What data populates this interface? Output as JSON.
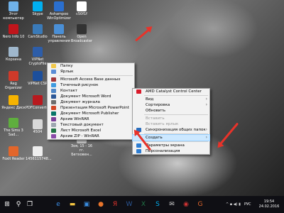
{
  "desktop_icons": [
    {
      "label": "Этот компьютер",
      "icon": "computer-icon",
      "color": "#6fb1e8"
    },
    {
      "label": "Skype",
      "icon": "skype-icon",
      "color": "#00aff0"
    },
    {
      "label": "Ashampoo WinOptimizer",
      "icon": "ashampoo-icon",
      "color": "#2a6fcf"
    },
    {
      "label": "c50f1f",
      "icon": "image-file-icon",
      "color": "#ffffff"
    },
    {
      "label": "Nero Info 10",
      "icon": "nero-icon",
      "color": "#c0151b"
    },
    {
      "label": "CamStudio",
      "icon": "camstudio-icon",
      "color": "#3a7ab8"
    },
    {
      "label": "Панель управления",
      "icon": "control-panel-icon",
      "color": "#4a8fd6"
    },
    {
      "label": "Open Broadcaster",
      "icon": "obs-icon",
      "color": "#333333"
    },
    {
      "label": "Корзина",
      "icon": "recycle-bin-icon",
      "color": "#9fb7cc"
    },
    {
      "label": "VIPNet CryptoFile",
      "icon": "vipnet-icon",
      "color": "#2d5da8"
    },
    {
      "label": "Reg Organizer",
      "icon": "reg-organizer-icon",
      "color": "#d03a2a"
    },
    {
      "label": "ViPNet CSP",
      "icon": "vipnet-csp-icon",
      "color": "#1c4f9c"
    },
    {
      "label": "Яндекс Диск",
      "icon": "yandex-disk-icon",
      "color": "#f6b300"
    },
    {
      "label": "PDFConverter",
      "icon": "pdf-icon",
      "color": "#b8191e"
    },
    {
      "label": "The Sims 3 Sad...",
      "icon": "sims-icon",
      "color": "#5fae3e"
    },
    {
      "label": "4504",
      "icon": "image-file-icon",
      "color": "#d8d8d8"
    },
    {
      "label": "Зоя, 15 - 16 гг. Бетховен...",
      "icon": "image-file-icon",
      "color": "#c8c8c8"
    },
    {
      "label": "Foxit Reader",
      "icon": "foxit-icon",
      "color": "#e2662b"
    },
    {
      "label": "1456115748...",
      "icon": "image-file-icon",
      "color": "#eeeeee"
    }
  ],
  "new_submenu": {
    "items": [
      {
        "label": "Папку",
        "icon": "folder-icon",
        "color": "#f2c94c"
      },
      {
        "label": "Ярлык",
        "icon": "shortcut-icon",
        "color": "#5b8dd6"
      },
      {
        "separator": true
      },
      {
        "label": "Microsoft Access Base данных",
        "icon": "access-icon",
        "color": "#a4373a"
      },
      {
        "label": "Точечный рисунок",
        "icon": "bitmap-icon",
        "color": "#3f9be0"
      },
      {
        "label": "Контакт",
        "icon": "contact-icon",
        "color": "#4f86c6"
      },
      {
        "label": "Документ Microsoft Word",
        "icon": "word-icon",
        "color": "#2b5797"
      },
      {
        "label": "Документ журнала",
        "icon": "journal-icon",
        "color": "#6d6d6d"
      },
      {
        "label": "Презентация Microsoft PowerPoint",
        "icon": "powerpoint-icon",
        "color": "#d24726"
      },
      {
        "label": "Документ Microsoft Publisher",
        "icon": "publisher-icon",
        "color": "#077568"
      },
      {
        "label": "Архив WinRAR",
        "icon": "winrar-icon",
        "color": "#7a3f99"
      },
      {
        "label": "Текстовый документ",
        "icon": "text-file-icon",
        "color": "#9ea7b1"
      },
      {
        "label": "Лист Microsoft Excel",
        "icon": "excel-icon",
        "color": "#217346"
      },
      {
        "label": "Архив ZIP - WinRAR",
        "icon": "zip-icon",
        "color": "#8a4aa8"
      }
    ]
  },
  "context_menu": {
    "items": [
      {
        "label": "AMD Catalyst Control Center",
        "icon": "amd-icon",
        "color": "#d91a2a"
      },
      {
        "separator": true
      },
      {
        "label": "Вид",
        "arrow": true
      },
      {
        "label": "Сортировка",
        "arrow": true
      },
      {
        "label": "Обновить"
      },
      {
        "separator": true
      },
      {
        "label": "Вставить",
        "disabled": true
      },
      {
        "label": "Вставить ярлык",
        "disabled": true
      },
      {
        "label": "Синхронизация общих папок",
        "icon": "sync-icon",
        "color": "#2a6ebd",
        "arrow": true
      },
      {
        "separator": true
      },
      {
        "label": "Создать",
        "arrow": true,
        "highlighted": true
      },
      {
        "separator": true
      },
      {
        "label": "Параметры экрана",
        "icon": "display-icon",
        "color": "#2d7dd2"
      },
      {
        "label": "Персонализация",
        "icon": "personalize-icon",
        "color": "#2d7dd2"
      }
    ]
  },
  "taskbar": {
    "icons": [
      {
        "name": "start-icon",
        "glyph": "⊞",
        "color": "#ffffff"
      },
      {
        "name": "search-icon",
        "glyph": "⚲",
        "color": "#ffffff"
      },
      {
        "name": "task-view-icon",
        "glyph": "❐",
        "color": "#ffffff"
      },
      {
        "name": "edge-icon",
        "glyph": "e",
        "color": "#3c8ee6"
      },
      {
        "name": "file-explorer-icon",
        "glyph": "▬",
        "color": "#f4c542"
      },
      {
        "name": "store-icon",
        "glyph": "▣",
        "color": "#3a8de0"
      },
      {
        "name": "firefox-icon",
        "glyph": "●",
        "color": "#e8742b"
      },
      {
        "name": "yandex-icon",
        "glyph": "Я",
        "color": "#e0342c"
      },
      {
        "name": "word-icon",
        "glyph": "W",
        "color": "#2b5797"
      },
      {
        "name": "excel-icon",
        "glyph": "X",
        "color": "#217346"
      },
      {
        "name": "skype-icon",
        "glyph": "S",
        "color": "#00aff0"
      },
      {
        "name": "mail-icon",
        "glyph": "✉",
        "color": "#cccccc"
      },
      {
        "name": "camera-icon",
        "glyph": "◉",
        "color": "#cc3333"
      },
      {
        "name": "foxit-icon",
        "glyph": "G",
        "color": "#e2662b"
      }
    ],
    "tray_glyph": "^ ▪ ◀) ▮",
    "language": "РУС",
    "time": "19:54",
    "date": "24.02.2016"
  }
}
